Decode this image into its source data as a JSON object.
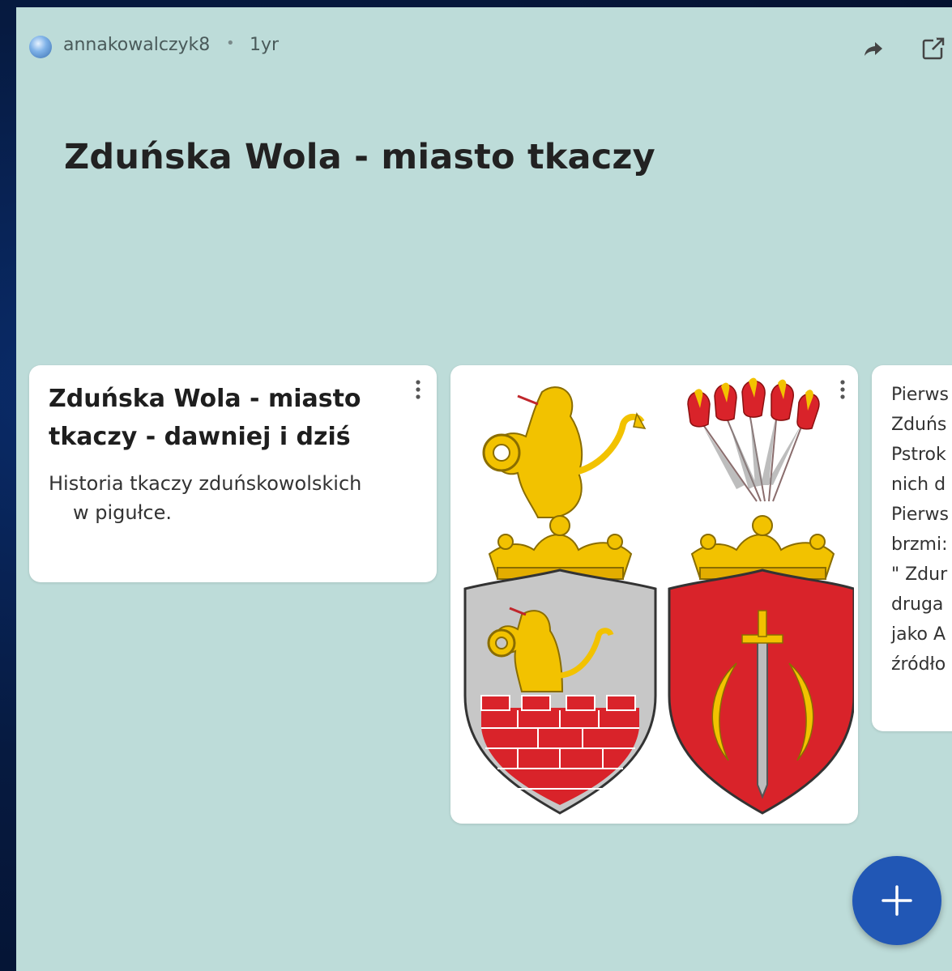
{
  "header": {
    "author": "annakowalczyk8",
    "separator": "•",
    "time": "1yr"
  },
  "board": {
    "title": "Zduńska Wola - miasto tkaczy"
  },
  "cards": [
    {
      "title": "Zduńska Wola - miasto tkaczy - dawniej i dziś",
      "description_line1": "Historia tkaczy zduńskowolskich",
      "description_line2": "w pigułce."
    },
    {
      "image": "coats-of-arms-illustration"
    },
    {
      "lines": [
        "Pierws",
        "Zduńs",
        "Pstrok",
        "nich d",
        "Pierws",
        "brzmi:",
        "\" Zdur",
        "druga",
        "jako A",
        "źródło"
      ]
    }
  ],
  "icons": {
    "share": "share-icon",
    "open": "open-external-icon",
    "more": "more-vertical-icon",
    "add": "plus-icon"
  },
  "colors": {
    "board_bg": "#bddcd9",
    "fab": "#2157b5",
    "gold": "#f2c200",
    "red": "#d9232a"
  }
}
